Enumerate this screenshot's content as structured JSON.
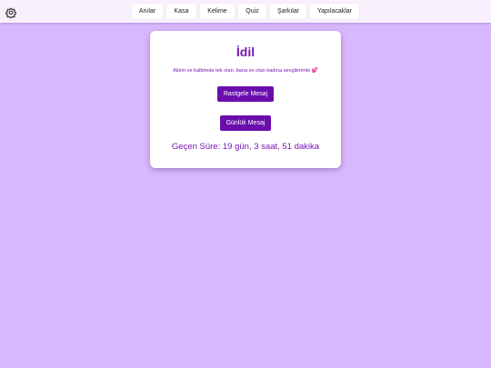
{
  "nav": {
    "items": [
      "Anılar",
      "Kasa",
      "Kelime",
      "Quiz",
      "Şarkılar",
      "Yapılacaklar"
    ]
  },
  "settings_icon": "gear-icon",
  "card": {
    "title": "İdil",
    "subtitle": "Aklım ve kalbimde tek olan, bana ev olan kadına sevgilerimle 💕",
    "random_button": "Rastgele Mesaj",
    "daily_button": "Günlük Mesaj",
    "elapsed_text": "Geçen Süre: 19 gün, 3 saat, 51 dakika"
  },
  "colors": {
    "background": "#d8b8fc",
    "accent": "#7a14b8",
    "button": "#6a0dad"
  }
}
